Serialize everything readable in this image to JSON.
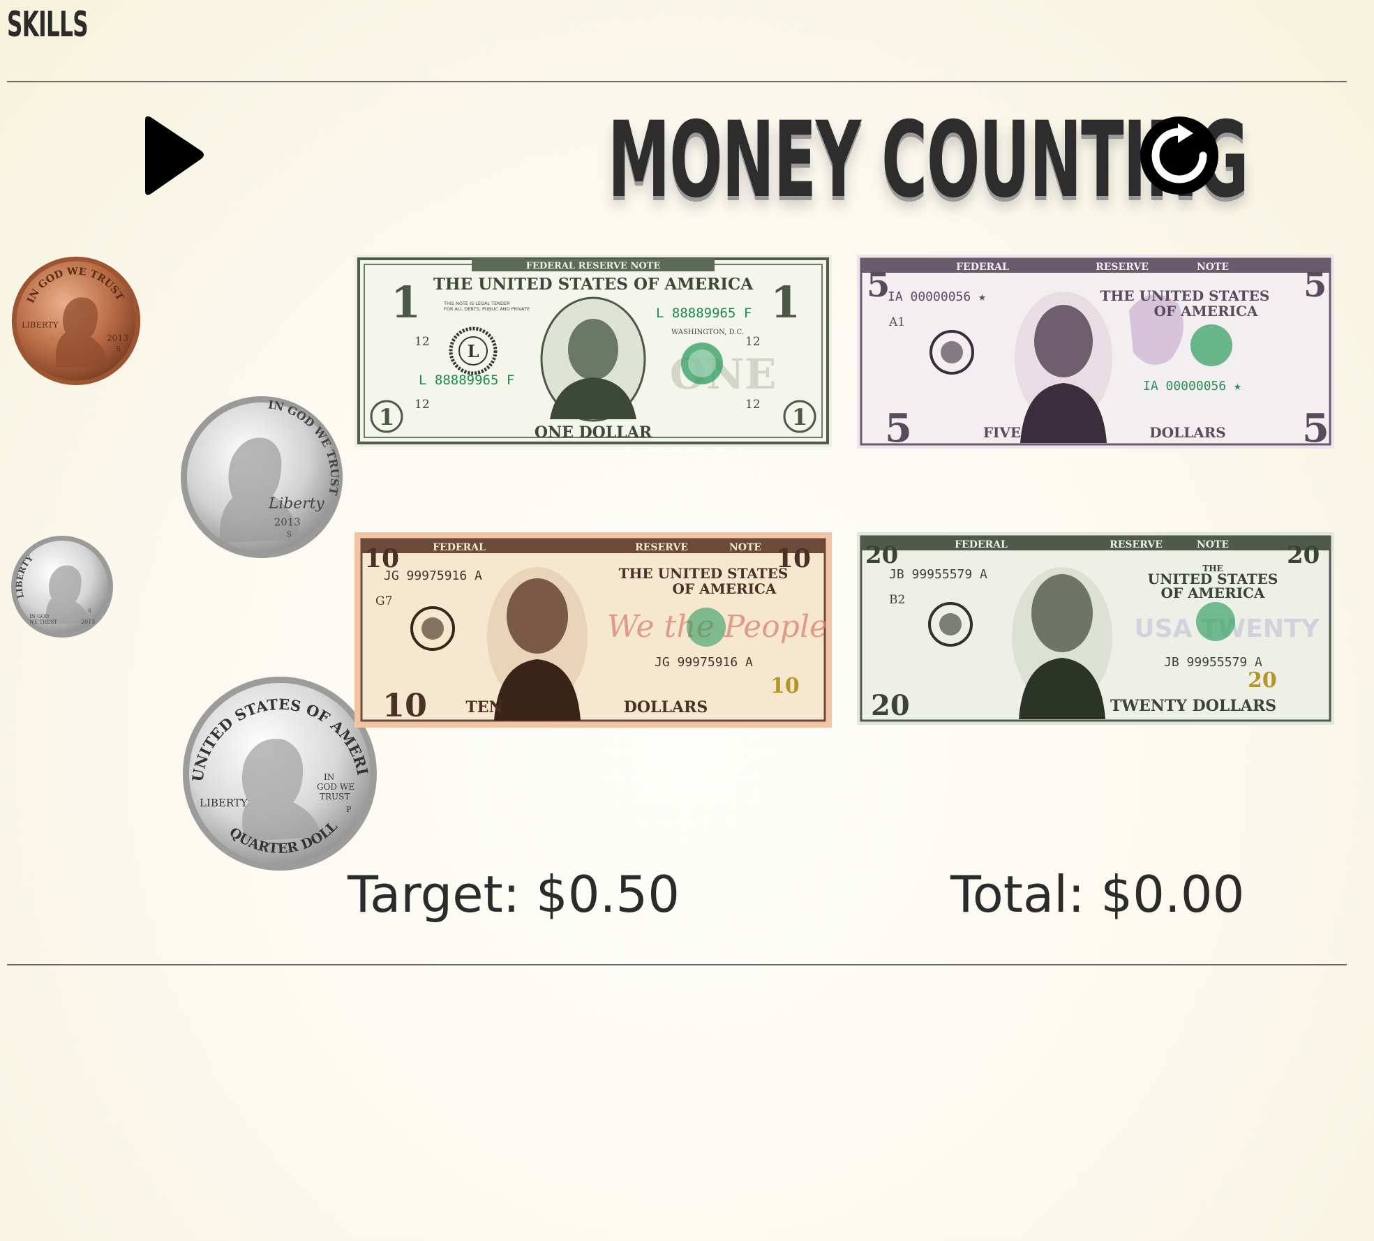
{
  "app": {
    "brand": "SKILLS",
    "title": "MONEY COUNTING"
  },
  "controls": {
    "play_icon": "play-icon",
    "reset_icon": "refresh-icon"
  },
  "coins": [
    {
      "name": "penny",
      "motto": "IN GOD WE TRUST",
      "left_text": "LIBERTY",
      "year": "2013",
      "mint": "S",
      "color": "#b86b45"
    },
    {
      "name": "nickel",
      "motto": "IN GOD WE TRUST",
      "script": "Liberty",
      "year": "2013",
      "mint": "S",
      "color": "#c9c9c9"
    },
    {
      "name": "dime",
      "left_text": "LIBERTY",
      "motto_l1": "IN GOD",
      "motto_l2": "WE TRUST",
      "year": "2013",
      "mint": "S",
      "color": "#cfcfcf"
    },
    {
      "name": "quarter",
      "top_text": "UNITED STATES OF AMERICA",
      "left_text": "LIBERTY",
      "motto_l1": "IN",
      "motto_l2": "GOD WE",
      "motto_l3": "TRUST",
      "mint": "P",
      "bottom_text": "QUARTER DOLLAR",
      "color": "#d4d4d4"
    }
  ],
  "bills": [
    {
      "denom": "1",
      "banner": "FEDERAL RESERVE NOTE",
      "header": "THE UNITED STATES OF AMERICA",
      "legal_l1": "THIS NOTE IS LEGAL TENDER",
      "legal_l2": "FOR ALL DEBTS, PUBLIC AND PRIVATE",
      "serial": "L 88889965 F",
      "seal_letter": "L",
      "plate": "12",
      "city": "WASHINGTON, D.C.",
      "watermark": "ONE",
      "footer": "ONE DOLLAR",
      "color": "#5b6b55"
    },
    {
      "denom": "5",
      "banner_left": "FEDERAL",
      "banner_mid": "RESERVE",
      "banner_right": "NOTE",
      "header_l1": "THE UNITED STATES",
      "header_l2": "OF AMERICA",
      "serial": "IA 00000056 ★",
      "plate": "A1",
      "footer_left": "FIVE",
      "footer_right": "DOLLARS",
      "color": "#6a5a6e"
    },
    {
      "denom": "10",
      "banner_left": "FEDERAL",
      "banner_mid": "RESERVE",
      "banner_right": "NOTE",
      "header_l1": "THE UNITED STATES",
      "header_l2": "OF AMERICA",
      "serial": "JG 99975916 A",
      "plate": "G7",
      "script": "We the People",
      "footer_left": "TEN",
      "footer_right": "DOLLARS",
      "color": "#6b4a3a"
    },
    {
      "denom": "20",
      "banner_left": "FEDERAL",
      "banner_mid": "RESERVE",
      "banner_right": "NOTE",
      "header_l0": "THE",
      "header_l1": "UNITED STATES",
      "header_l2": "OF AMERICA",
      "serial": "JB 99955579 A",
      "plate": "B2",
      "watermark": "USA TWENTY",
      "footer": "TWENTY DOLLARS",
      "color": "#4f5a4a"
    }
  ],
  "scoreboard": {
    "target_label": "Target: $0.50",
    "total_label": "Total: $0.00"
  }
}
